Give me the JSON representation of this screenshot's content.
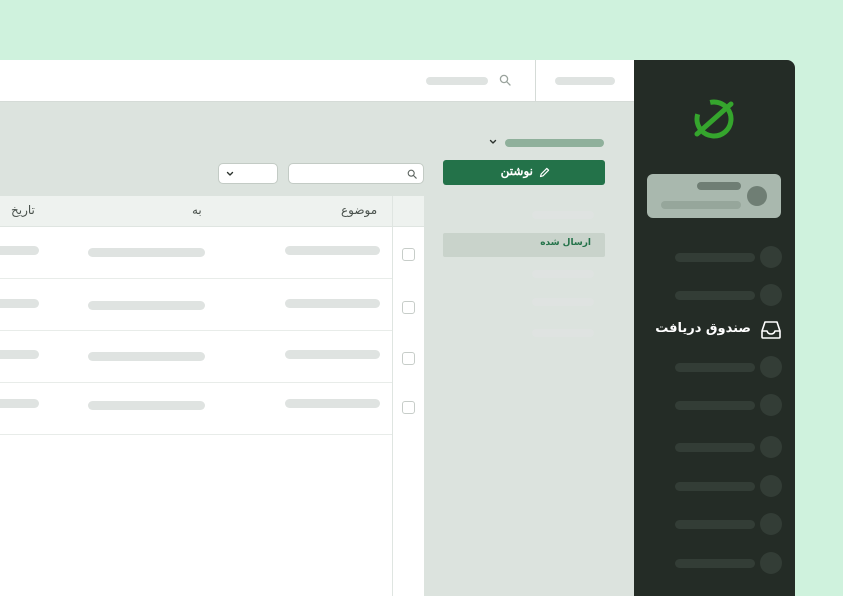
{
  "sidebar": {
    "active_item": {
      "label": "صندوق دریافت",
      "icon": "inbox-icon"
    },
    "other_items_count": 8
  },
  "folders": {
    "compose_label": "نوشتن",
    "compose_icon": "pencil-icon",
    "sent_label": "ارسال شده"
  },
  "list": {
    "columns": {
      "subject": "موضوع",
      "to": "به",
      "date": "تاریخ"
    }
  },
  "colors": {
    "accent": "#237249",
    "sidebar": "#242c26",
    "page_background": "#cff2dd",
    "logo_green": "#35a52d"
  }
}
